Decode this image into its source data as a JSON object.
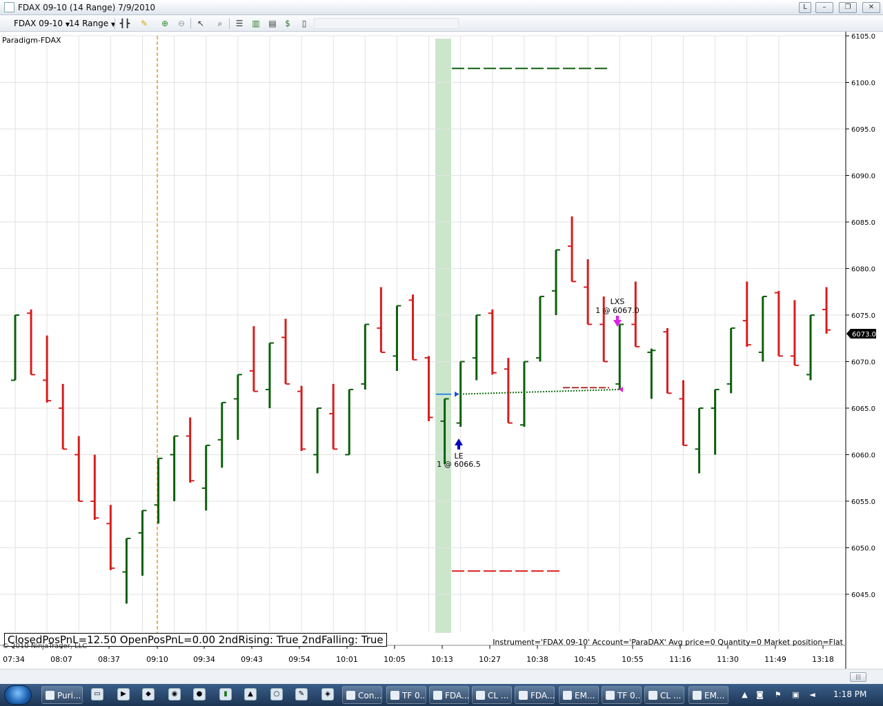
{
  "window": {
    "title": "FDAX 09-10 (14 Range)  7/9/2010",
    "buttons": [
      "L",
      "–",
      "❐",
      "✕"
    ]
  },
  "toolbar": {
    "instrument": "FDAX 09-10",
    "interval": "14 Range",
    "icons": [
      "bar-style-icon",
      "pencil-draw-icon",
      "zoom-in-icon",
      "zoom-out-icon",
      "cursor-icon",
      "magnifier-icon",
      "properties-icon",
      "chart-trader-icon",
      "data-box-icon",
      "dollar-icon",
      "strategy-icon"
    ]
  },
  "chart": {
    "indicator_label": "Paradigm-FDAX",
    "stats_text": "ClosedPosPnL=12.50 OpenPosPnL=0.00 2ndRising: True 2ndFalling: True",
    "copyright": "© 2010 NinjaTrader, LLC",
    "account_info": "Instrument='FDAX 09-10' Account='ParaDAX' Avg price=0 Quantity=0 Market position=Flat",
    "last_price_label": "6073.0",
    "colors": {
      "up": "#0b5e0b",
      "down": "#d81c1c",
      "grid": "#e2e2e2",
      "highlight": "#cce6cc",
      "vline": "#e39a1a"
    }
  },
  "chart_data": {
    "type": "bar",
    "y_ticks": [
      "6105.0",
      "6100.0",
      "6095.0",
      "6090.0",
      "6085.0",
      "6080.0",
      "6075.0",
      "6070.0",
      "6065.0",
      "6060.0",
      "6055.0",
      "6050.0",
      "6045.0"
    ],
    "ylim": [
      6040.7,
      6105.0
    ],
    "x_ticks": [
      "07:34",
      "08:07",
      "08:37",
      "09:10",
      "09:34",
      "09:43",
      "09:54",
      "10:01",
      "10:05",
      "10:13",
      "10:27",
      "10:38",
      "10:45",
      "10:55",
      "11:16",
      "11:30",
      "11:49",
      "13:18"
    ],
    "bars": [
      {
        "h": 6075.0,
        "l": 6068.0,
        "o": 6068.0,
        "c": 6075.0,
        "up": true
      },
      {
        "h": 6075.6,
        "l": 6068.6,
        "o": 6075.2,
        "c": 6068.6,
        "up": false
      },
      {
        "h": 6072.8,
        "l": 6065.6,
        "o": 6068.0,
        "c": 6065.8,
        "up": false
      },
      {
        "h": 6067.6,
        "l": 6060.6,
        "o": 6065.0,
        "c": 6060.6,
        "up": false
      },
      {
        "h": 6062.0,
        "l": 6055.0,
        "o": 6060.0,
        "c": 6055.0,
        "up": false
      },
      {
        "h": 6060.0,
        "l": 6053.0,
        "o": 6055.0,
        "c": 6053.2,
        "up": false
      },
      {
        "h": 6054.6,
        "l": 6047.6,
        "o": 6052.6,
        "c": 6047.8,
        "up": false
      },
      {
        "h": 6051.0,
        "l": 6044.0,
        "o": 6047.4,
        "c": 6051.0,
        "up": true
      },
      {
        "h": 6054.0,
        "l": 6047.0,
        "o": 6051.6,
        "c": 6054.0,
        "up": true
      },
      {
        "h": 6059.6,
        "l": 6052.6,
        "o": 6054.6,
        "c": 6059.6,
        "up": true
      },
      {
        "h": 6062.0,
        "l": 6055.0,
        "o": 6060.0,
        "c": 6062.0,
        "up": true
      },
      {
        "h": 6064.0,
        "l": 6057.0,
        "o": 6062.0,
        "c": 6057.2,
        "up": false
      },
      {
        "h": 6061.0,
        "l": 6054.0,
        "o": 6056.4,
        "c": 6061.0,
        "up": true
      },
      {
        "h": 6065.6,
        "l": 6058.6,
        "o": 6061.6,
        "c": 6065.6,
        "up": true
      },
      {
        "h": 6068.6,
        "l": 6061.6,
        "o": 6066.0,
        "c": 6068.6,
        "up": true
      },
      {
        "h": 6073.8,
        "l": 6066.8,
        "o": 6069.0,
        "c": 6066.8,
        "up": false
      },
      {
        "h": 6072.0,
        "l": 6065.0,
        "o": 6067.0,
        "c": 6072.0,
        "up": true
      },
      {
        "h": 6074.6,
        "l": 6067.6,
        "o": 6072.6,
        "c": 6067.6,
        "up": false
      },
      {
        "h": 6067.4,
        "l": 6060.4,
        "o": 6066.8,
        "c": 6060.6,
        "up": false
      },
      {
        "h": 6065.0,
        "l": 6058.0,
        "o": 6060.0,
        "c": 6065.0,
        "up": true
      },
      {
        "h": 6067.6,
        "l": 6060.6,
        "o": 6064.4,
        "c": 6060.6,
        "up": false
      },
      {
        "h": 6067.0,
        "l": 6060.0,
        "o": 6060.0,
        "c": 6067.0,
        "up": true
      },
      {
        "h": 6074.0,
        "l": 6067.0,
        "o": 6067.6,
        "c": 6074.0,
        "up": true
      },
      {
        "h": 6078.0,
        "l": 6071.0,
        "o": 6073.6,
        "c": 6071.0,
        "up": false
      },
      {
        "h": 6076.0,
        "l": 6069.0,
        "o": 6070.6,
        "c": 6076.0,
        "up": true
      },
      {
        "h": 6077.2,
        "l": 6070.2,
        "o": 6076.6,
        "c": 6070.2,
        "up": false
      },
      {
        "h": 6070.6,
        "l": 6063.6,
        "o": 6070.4,
        "c": 6064.0,
        "up": false
      },
      {
        "h": 6066.0,
        "l": 6059.0,
        "o": 6063.6,
        "c": 6066.0,
        "up": true
      },
      {
        "h": 6070.0,
        "l": 6063.0,
        "o": 6063.4,
        "c": 6070.0,
        "up": true
      },
      {
        "h": 6075.0,
        "l": 6068.0,
        "o": 6070.4,
        "c": 6075.0,
        "up": true
      },
      {
        "h": 6075.6,
        "l": 6068.6,
        "o": 6075.2,
        "c": 6068.8,
        "up": false
      },
      {
        "h": 6070.4,
        "l": 6063.4,
        "o": 6069.2,
        "c": 6063.4,
        "up": false
      },
      {
        "h": 6070.0,
        "l": 6063.0,
        "o": 6063.2,
        "c": 6070.0,
        "up": true
      },
      {
        "h": 6077.0,
        "l": 6070.0,
        "o": 6070.4,
        "c": 6077.0,
        "up": true
      },
      {
        "h": 6082.0,
        "l": 6075.0,
        "o": 6077.6,
        "c": 6082.0,
        "up": true
      },
      {
        "h": 6085.6,
        "l": 6078.6,
        "o": 6082.4,
        "c": 6078.6,
        "up": false
      },
      {
        "h": 6081.0,
        "l": 6074.0,
        "o": 6078.0,
        "c": 6074.0,
        "up": false
      },
      {
        "h": 6077.0,
        "l": 6070.0,
        "o": 6074.0,
        "c": 6070.0,
        "up": false
      },
      {
        "h": 6074.0,
        "l": 6067.0,
        "o": 6067.6,
        "c": 6074.0,
        "up": true
      },
      {
        "h": 6078.6,
        "l": 6071.6,
        "o": 6074.0,
        "c": 6071.6,
        "up": false
      },
      {
        "h": 6071.4,
        "l": 6066.0,
        "o": 6071.0,
        "c": 6071.2,
        "up": true
      },
      {
        "h": 6073.6,
        "l": 6066.6,
        "o": 6073.2,
        "c": 6066.6,
        "up": false
      },
      {
        "h": 6068.0,
        "l": 6061.0,
        "o": 6066.0,
        "c": 6061.0,
        "up": false
      },
      {
        "h": 6065.0,
        "l": 6058.0,
        "o": 6060.6,
        "c": 6065.0,
        "up": true
      },
      {
        "h": 6067.0,
        "l": 6060.0,
        "o": 6065.0,
        "c": 6067.0,
        "up": true
      },
      {
        "h": 6073.6,
        "l": 6066.6,
        "o": 6067.6,
        "c": 6073.6,
        "up": true
      },
      {
        "h": 6078.6,
        "l": 6071.6,
        "o": 6074.4,
        "c": 6071.8,
        "up": false
      },
      {
        "h": 6077.0,
        "l": 6070.0,
        "o": 6071.0,
        "c": 6077.0,
        "up": true
      },
      {
        "h": 6077.6,
        "l": 6070.6,
        "o": 6077.4,
        "c": 6070.6,
        "up": false
      },
      {
        "h": 6076.6,
        "l": 6069.6,
        "o": 6070.6,
        "c": 6069.6,
        "up": false
      },
      {
        "h": 6075.0,
        "l": 6068.0,
        "o": 6068.6,
        "c": 6075.0,
        "up": true
      },
      {
        "h": 6078.0,
        "l": 6073.0,
        "o": 6075.6,
        "c": 6073.4,
        "up": false
      }
    ],
    "entry": {
      "label": "LE",
      "detail": "1 @ 6066.5",
      "price": 6066.5
    },
    "exit": {
      "label": "LXS",
      "detail": "1 @ 6067.0",
      "price": 6067.0
    },
    "target_price": 6101.5,
    "stop_price": 6047.5
  },
  "taskbar": {
    "buttons": [
      "Puri...",
      "Con...",
      "TF 0...",
      "FDA...",
      "CL ...",
      "FDA...",
      "EM...",
      "TF 0...",
      "CL ...",
      "EM..."
    ],
    "clock": "1:18 PM"
  }
}
